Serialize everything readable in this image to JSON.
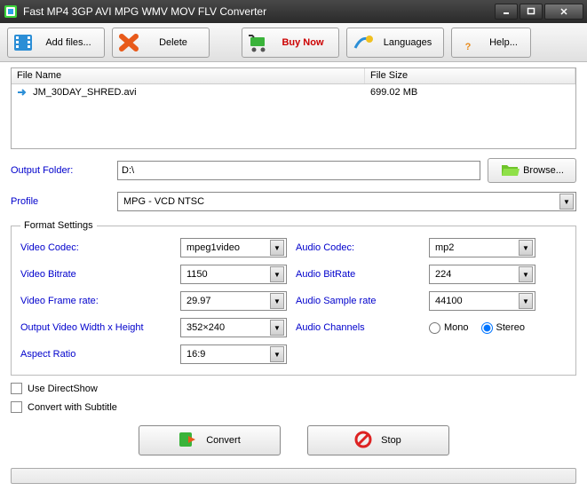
{
  "window": {
    "title": "Fast MP4 3GP AVI MPG WMV MOV FLV Converter"
  },
  "toolbar": {
    "add_files": "Add files...",
    "delete": "Delete",
    "buy_now": "Buy Now",
    "languages": "Languages",
    "help": "Help..."
  },
  "filelist": {
    "header_name": "File Name",
    "header_size": "File Size",
    "rows": [
      {
        "name": "JM_30DAY_SHRED.avi",
        "size": "699.02 MB"
      }
    ]
  },
  "output": {
    "folder_label": "Output Folder:",
    "folder_value": "D:\\",
    "browse": "Browse...",
    "profile_label": "Profile",
    "profile_value": "MPG - VCD NTSC"
  },
  "format": {
    "legend": "Format Settings",
    "video_codec_label": "Video Codec:",
    "video_codec": "mpeg1video",
    "video_bitrate_label": "Video Bitrate",
    "video_bitrate": "1150",
    "video_framerate_label": "Video Frame rate:",
    "video_framerate": "29.97",
    "video_wh_label": "Output Video Width x Height",
    "video_wh": "352×240",
    "aspect_label": "Aspect Ratio",
    "aspect": "16:9",
    "audio_codec_label": "Audio Codec:",
    "audio_codec": "mp2",
    "audio_bitrate_label": "Audio BitRate",
    "audio_bitrate": "224",
    "audio_sample_label": "Audio Sample rate",
    "audio_sample": "44100",
    "audio_channels_label": "Audio Channels",
    "mono": "Mono",
    "stereo": "Stereo"
  },
  "options": {
    "directshow": "Use DirectShow",
    "subtitle": "Convert with Subtitle"
  },
  "actions": {
    "convert": "Convert",
    "stop": "Stop"
  }
}
